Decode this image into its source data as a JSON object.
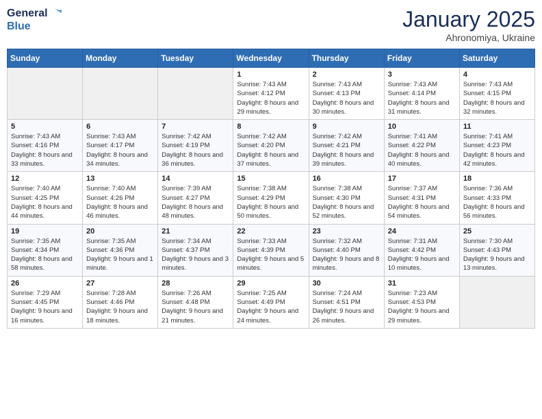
{
  "header": {
    "logo_line1": "General",
    "logo_line2": "Blue",
    "month": "January 2025",
    "location": "Ahronomiya, Ukraine"
  },
  "weekdays": [
    "Sunday",
    "Monday",
    "Tuesday",
    "Wednesday",
    "Thursday",
    "Friday",
    "Saturday"
  ],
  "weeks": [
    [
      {
        "day": "",
        "info": ""
      },
      {
        "day": "",
        "info": ""
      },
      {
        "day": "",
        "info": ""
      },
      {
        "day": "1",
        "info": "Sunrise: 7:43 AM\nSunset: 4:12 PM\nDaylight: 8 hours and 29 minutes."
      },
      {
        "day": "2",
        "info": "Sunrise: 7:43 AM\nSunset: 4:13 PM\nDaylight: 8 hours and 30 minutes."
      },
      {
        "day": "3",
        "info": "Sunrise: 7:43 AM\nSunset: 4:14 PM\nDaylight: 8 hours and 31 minutes."
      },
      {
        "day": "4",
        "info": "Sunrise: 7:43 AM\nSunset: 4:15 PM\nDaylight: 8 hours and 32 minutes."
      }
    ],
    [
      {
        "day": "5",
        "info": "Sunrise: 7:43 AM\nSunset: 4:16 PM\nDaylight: 8 hours and 33 minutes."
      },
      {
        "day": "6",
        "info": "Sunrise: 7:43 AM\nSunset: 4:17 PM\nDaylight: 8 hours and 34 minutes."
      },
      {
        "day": "7",
        "info": "Sunrise: 7:42 AM\nSunset: 4:19 PM\nDaylight: 8 hours and 36 minutes."
      },
      {
        "day": "8",
        "info": "Sunrise: 7:42 AM\nSunset: 4:20 PM\nDaylight: 8 hours and 37 minutes."
      },
      {
        "day": "9",
        "info": "Sunrise: 7:42 AM\nSunset: 4:21 PM\nDaylight: 8 hours and 39 minutes."
      },
      {
        "day": "10",
        "info": "Sunrise: 7:41 AM\nSunset: 4:22 PM\nDaylight: 8 hours and 40 minutes."
      },
      {
        "day": "11",
        "info": "Sunrise: 7:41 AM\nSunset: 4:23 PM\nDaylight: 8 hours and 42 minutes."
      }
    ],
    [
      {
        "day": "12",
        "info": "Sunrise: 7:40 AM\nSunset: 4:25 PM\nDaylight: 8 hours and 44 minutes."
      },
      {
        "day": "13",
        "info": "Sunrise: 7:40 AM\nSunset: 4:26 PM\nDaylight: 8 hours and 46 minutes."
      },
      {
        "day": "14",
        "info": "Sunrise: 7:39 AM\nSunset: 4:27 PM\nDaylight: 8 hours and 48 minutes."
      },
      {
        "day": "15",
        "info": "Sunrise: 7:38 AM\nSunset: 4:29 PM\nDaylight: 8 hours and 50 minutes."
      },
      {
        "day": "16",
        "info": "Sunrise: 7:38 AM\nSunset: 4:30 PM\nDaylight: 8 hours and 52 minutes."
      },
      {
        "day": "17",
        "info": "Sunrise: 7:37 AM\nSunset: 4:31 PM\nDaylight: 8 hours and 54 minutes."
      },
      {
        "day": "18",
        "info": "Sunrise: 7:36 AM\nSunset: 4:33 PM\nDaylight: 8 hours and 56 minutes."
      }
    ],
    [
      {
        "day": "19",
        "info": "Sunrise: 7:35 AM\nSunset: 4:34 PM\nDaylight: 8 hours and 58 minutes."
      },
      {
        "day": "20",
        "info": "Sunrise: 7:35 AM\nSunset: 4:36 PM\nDaylight: 9 hours and 1 minute."
      },
      {
        "day": "21",
        "info": "Sunrise: 7:34 AM\nSunset: 4:37 PM\nDaylight: 9 hours and 3 minutes."
      },
      {
        "day": "22",
        "info": "Sunrise: 7:33 AM\nSunset: 4:39 PM\nDaylight: 9 hours and 5 minutes."
      },
      {
        "day": "23",
        "info": "Sunrise: 7:32 AM\nSunset: 4:40 PM\nDaylight: 9 hours and 8 minutes."
      },
      {
        "day": "24",
        "info": "Sunrise: 7:31 AM\nSunset: 4:42 PM\nDaylight: 9 hours and 10 minutes."
      },
      {
        "day": "25",
        "info": "Sunrise: 7:30 AM\nSunset: 4:43 PM\nDaylight: 9 hours and 13 minutes."
      }
    ],
    [
      {
        "day": "26",
        "info": "Sunrise: 7:29 AM\nSunset: 4:45 PM\nDaylight: 9 hours and 16 minutes."
      },
      {
        "day": "27",
        "info": "Sunrise: 7:28 AM\nSunset: 4:46 PM\nDaylight: 9 hours and 18 minutes."
      },
      {
        "day": "28",
        "info": "Sunrise: 7:26 AM\nSunset: 4:48 PM\nDaylight: 9 hours and 21 minutes."
      },
      {
        "day": "29",
        "info": "Sunrise: 7:25 AM\nSunset: 4:49 PM\nDaylight: 9 hours and 24 minutes."
      },
      {
        "day": "30",
        "info": "Sunrise: 7:24 AM\nSunset: 4:51 PM\nDaylight: 9 hours and 26 minutes."
      },
      {
        "day": "31",
        "info": "Sunrise: 7:23 AM\nSunset: 4:53 PM\nDaylight: 9 hours and 29 minutes."
      },
      {
        "day": "",
        "info": ""
      }
    ]
  ]
}
